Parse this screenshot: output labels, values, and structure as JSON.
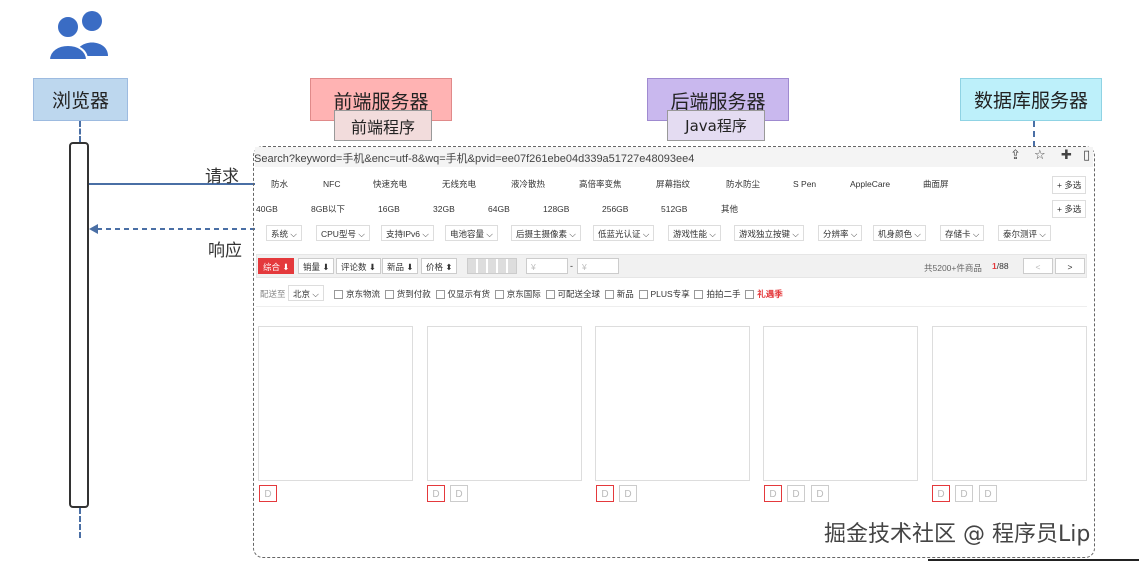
{
  "actors": {
    "browser": "浏览器",
    "frontend": "前端服务器",
    "frontend_sub": "前端程序",
    "backend": "后端服务器",
    "backend_sub": "Java程序",
    "database": "数据库服务器"
  },
  "arrows": {
    "request": "请求",
    "response": "响应"
  },
  "colors": {
    "browser": "#bdd7ee",
    "frontend": "#ffb3b3",
    "backend": "#c9b8ee",
    "database": "#bdf0fa",
    "accent": "#e4393c"
  },
  "page": {
    "url": "Search?keyword=手机&enc=utf-8&wq=手机&pvid=ee07f261ebe04d339a51727e48093ee4",
    "toolbar_icons": [
      "share-icon",
      "star-icon",
      "extension-icon",
      "sidebar-icon"
    ],
    "row1": [
      "防水",
      "NFC",
      "快速充电",
      "无线充电",
      "液冷散热",
      "高倍率变焦",
      "屏幕指纹",
      "防水防尘",
      "S Pen",
      "AppleCare",
      "曲面屏"
    ],
    "row2": [
      "40GB",
      "8GB以下",
      "16GB",
      "32GB",
      "64GB",
      "128GB",
      "256GB",
      "512GB",
      "其他"
    ],
    "more": "+ 多选",
    "filters": [
      "系统",
      "CPU型号",
      "支持IPv6",
      "电池容量",
      "后摄主摄像素",
      "低蓝光认证",
      "游戏性能",
      "游戏独立按键",
      "分辨率",
      "机身颜色",
      "存储卡",
      "泰尔测评"
    ],
    "sort": {
      "comprehensive": "综合 ⬇",
      "sales": "销量 ⬇",
      "comments": "评论数 ⬇",
      "new": "新品 ⬇",
      "price": "价格 ⬍",
      "price_from": "¥",
      "price_to": "¥",
      "dash": "-",
      "total": "共5200+件商品",
      "page_current": "1",
      "page_total": "/88",
      "prev": "<",
      "next": ">"
    },
    "ship": {
      "label": "配送至",
      "region": "北京",
      "options": [
        "京东物流",
        "货到付款",
        "仅显示有货",
        "京东国际",
        "可配送全球",
        "新品",
        "PLUS专享",
        "拍拍二手"
      ],
      "highlight": "礼遇季"
    }
  },
  "watermark": "掘金技术社区 @ 程序员Lip"
}
